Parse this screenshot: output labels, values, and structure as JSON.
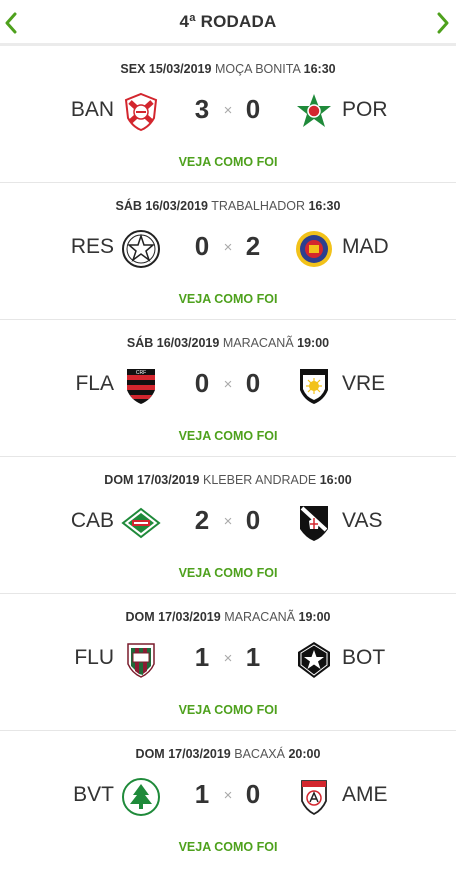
{
  "round": {
    "title": "4ª RODADA"
  },
  "link_label": "VEJA COMO FOI",
  "colors": {
    "accent": "#4ea11d",
    "text": "#333333",
    "muted": "#aaaaaa"
  },
  "matches": [
    {
      "weekday": "SEX",
      "date": "15/03/2019",
      "venue": "MOÇA BONITA",
      "time": "16:30",
      "home": {
        "abbr": "BAN",
        "crest": "bangu-crest-icon"
      },
      "home_score": "3",
      "away": {
        "abbr": "POR",
        "crest": "portuguesa-crest-icon"
      },
      "away_score": "0"
    },
    {
      "weekday": "SÁB",
      "date": "16/03/2019",
      "venue": "TRABALHADOR",
      "time": "16:30",
      "home": {
        "abbr": "RES",
        "crest": "resende-crest-icon"
      },
      "home_score": "0",
      "away": {
        "abbr": "MAD",
        "crest": "madureira-crest-icon"
      },
      "away_score": "2"
    },
    {
      "weekday": "SÁB",
      "date": "16/03/2019",
      "venue": "MARACANÃ",
      "time": "19:00",
      "home": {
        "abbr": "FLA",
        "crest": "flamengo-crest-icon"
      },
      "home_score": "0",
      "away": {
        "abbr": "VRE",
        "crest": "volta-redonda-crest-icon"
      },
      "away_score": "0"
    },
    {
      "weekday": "DOM",
      "date": "17/03/2019",
      "venue": "KLEBER ANDRADE",
      "time": "16:00",
      "home": {
        "abbr": "CAB",
        "crest": "cabofriense-crest-icon"
      },
      "home_score": "2",
      "away": {
        "abbr": "VAS",
        "crest": "vasco-crest-icon"
      },
      "away_score": "0"
    },
    {
      "weekday": "DOM",
      "date": "17/03/2019",
      "venue": "MARACANÃ",
      "time": "19:00",
      "home": {
        "abbr": "FLU",
        "crest": "fluminense-crest-icon"
      },
      "home_score": "1",
      "away": {
        "abbr": "BOT",
        "crest": "botafogo-crest-icon"
      },
      "away_score": "1"
    },
    {
      "weekday": "DOM",
      "date": "17/03/2019",
      "venue": "BACAXÁ",
      "time": "20:00",
      "home": {
        "abbr": "BVT",
        "crest": "boavista-crest-icon"
      },
      "home_score": "1",
      "away": {
        "abbr": "AME",
        "crest": "america-crest-icon"
      },
      "away_score": "0"
    }
  ]
}
